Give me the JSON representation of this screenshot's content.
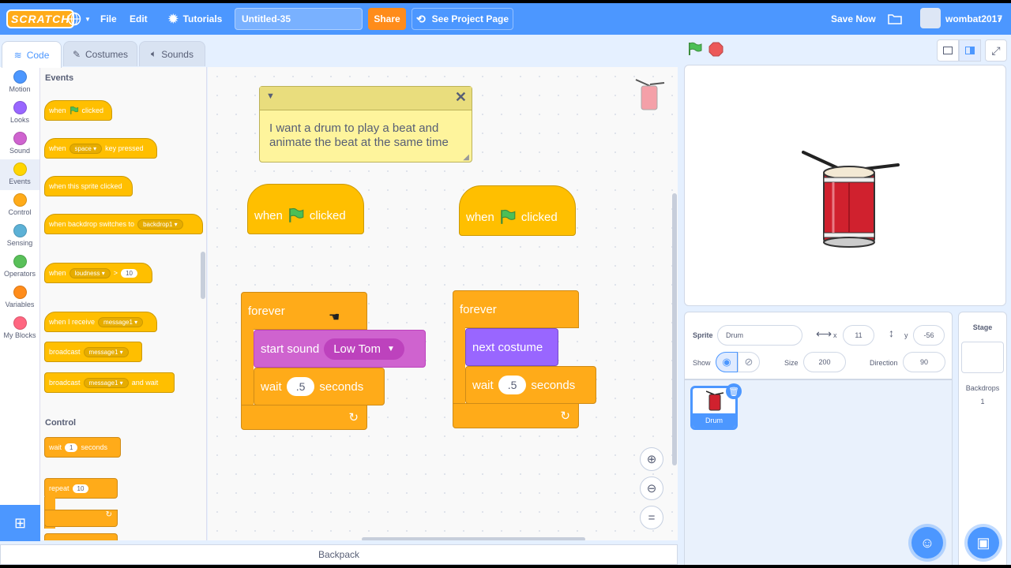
{
  "menubar": {
    "logo": "SCRATCH",
    "file": "File",
    "edit": "Edit",
    "tutorials": "Tutorials",
    "project_title": "Untitled-35",
    "share": "Share",
    "see_project_page": "See Project Page",
    "save_now": "Save Now",
    "username": "wombat2017"
  },
  "tabs": {
    "code": "Code",
    "costumes": "Costumes",
    "sounds": "Sounds"
  },
  "categories": [
    {
      "label": "Motion",
      "color": "#4c97ff"
    },
    {
      "label": "Looks",
      "color": "#9966ff"
    },
    {
      "label": "Sound",
      "color": "#cf63cf"
    },
    {
      "label": "Events",
      "color": "#ffd500"
    },
    {
      "label": "Control",
      "color": "#ffab19"
    },
    {
      "label": "Sensing",
      "color": "#5cb1d6"
    },
    {
      "label": "Operators",
      "color": "#59c059"
    },
    {
      "label": "Variables",
      "color": "#ff8c1a"
    },
    {
      "label": "My Blocks",
      "color": "#ff6680"
    }
  ],
  "palette": {
    "events_heading": "Events",
    "control_heading": "Control",
    "when": "when",
    "clicked": "clicked",
    "space": "space",
    "key_pressed": "key pressed",
    "when_sprite_clicked": "when this sprite clicked",
    "when_backdrop_switches": "when backdrop switches to",
    "backdrop1": "backdrop1",
    "loudness": "loudness",
    "gt": ">",
    "loud_value": "10",
    "when_i_receive": "when I receive",
    "message1": "message1",
    "broadcast": "broadcast",
    "and_wait": "and wait",
    "wait": "wait",
    "wait_value": "1",
    "seconds": "seconds",
    "repeat": "repeat",
    "repeat_value": "10"
  },
  "workspace": {
    "comment": "I want a drum to play a beat and\nanimate the beat at the same time",
    "when": "when",
    "clicked": "clicked",
    "forever": "forever",
    "start_sound": "start sound",
    "sound_name": "Low Tom",
    "wait": "wait",
    "wait_value": ".5",
    "seconds": "seconds",
    "next_costume": "next costume"
  },
  "sprite_info": {
    "sprite_label": "Sprite",
    "sprite_name": "Drum",
    "x_label": "x",
    "x_value": "11",
    "y_label": "y",
    "y_value": "-56",
    "show_label": "Show",
    "size_label": "Size",
    "size_value": "200",
    "direction_label": "Direction",
    "direction_value": "90"
  },
  "sprite_list": {
    "sprite_name": "Drum"
  },
  "stage_selector": {
    "title": "Stage",
    "backdrops_label": "Backdrops",
    "backdrops_count": "1"
  },
  "backpack": "Backpack"
}
